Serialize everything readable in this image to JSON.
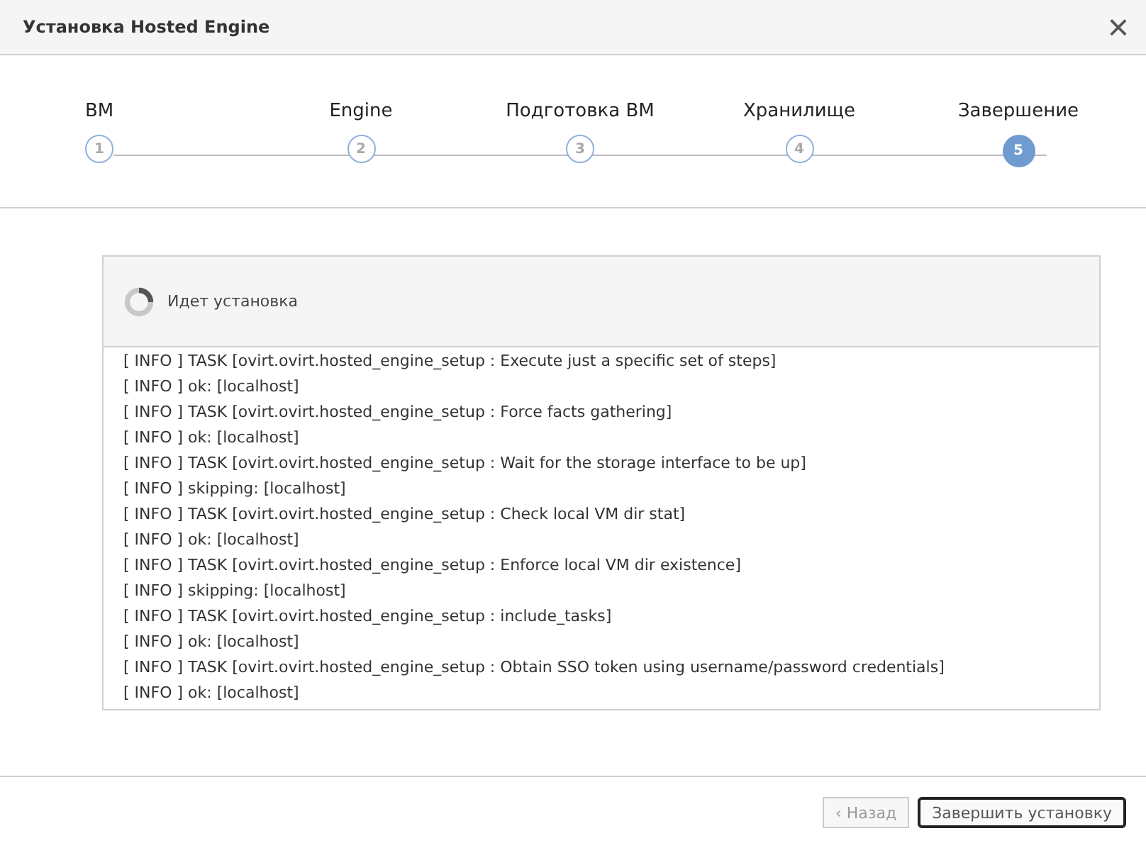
{
  "window": {
    "title": "Установка Hosted Engine",
    "close": "×"
  },
  "steps": [
    {
      "label": "ВМ",
      "number": "1",
      "selected": false
    },
    {
      "label": "Engine",
      "number": "2",
      "selected": false
    },
    {
      "label": "Подготовка ВМ",
      "number": "3",
      "selected": false
    },
    {
      "label": "Хранилище",
      "number": "4",
      "selected": false
    },
    {
      "label": "Завершение",
      "number": "5",
      "selected": true
    }
  ],
  "progress": {
    "status": "Идет установка"
  },
  "log": [
    "[ INFO ] TASK [ovirt.ovirt.hosted_engine_setup : Execute just a specific set of steps]",
    "[ INFO ] ok: [localhost]",
    "[ INFO ] TASK [ovirt.ovirt.hosted_engine_setup : Force facts gathering]",
    "[ INFO ] ok: [localhost]",
    "[ INFO ] TASK [ovirt.ovirt.hosted_engine_setup : Wait for the storage interface to be up]",
    "[ INFO ] skipping: [localhost]",
    "[ INFO ] TASK [ovirt.ovirt.hosted_engine_setup : Check local VM dir stat]",
    "[ INFO ] ok: [localhost]",
    "[ INFO ] TASK [ovirt.ovirt.hosted_engine_setup : Enforce local VM dir existence]",
    "[ INFO ] skipping: [localhost]",
    "[ INFO ] TASK [ovirt.ovirt.hosted_engine_setup : include_tasks]",
    "[ INFO ] ok: [localhost]",
    "[ INFO ] TASK [ovirt.ovirt.hosted_engine_setup : Obtain SSO token using username/password credentials]",
    "[ INFO ] ok: [localhost]"
  ],
  "buttons": [
    {
      "label": "‹ Назад",
      "disabled": true,
      "focused": false
    },
    {
      "label": "Завершить установку",
      "disabled": false,
      "focused": true
    }
  ]
}
